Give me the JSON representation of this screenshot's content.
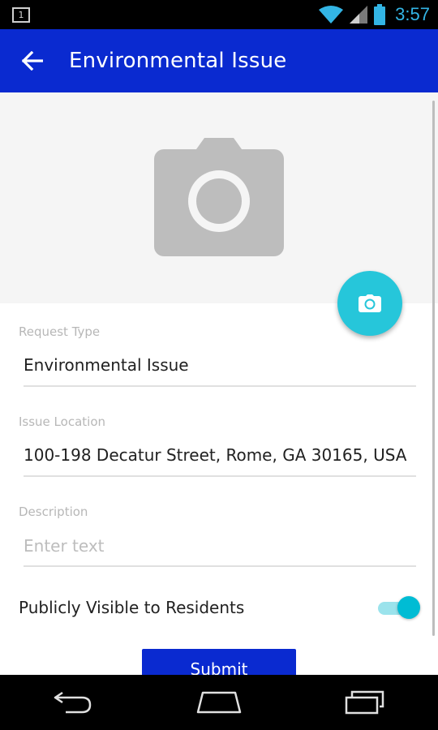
{
  "status_bar": {
    "notification_count": "1",
    "time": "3:57",
    "icons": [
      "wifi-icon",
      "cell-signal-icon",
      "battery-icon"
    ]
  },
  "app_bar": {
    "title": "Environmental Issue",
    "back_icon": "arrow-left-icon"
  },
  "photo": {
    "placeholder_icon": "camera-icon",
    "fab_icon": "camera-icon"
  },
  "form": {
    "request_type": {
      "label": "Request Type",
      "value": "Environmental Issue"
    },
    "issue_location": {
      "label": "Issue Location",
      "value": "100-198 Decatur Street, Rome, GA 30165, USA"
    },
    "description": {
      "label": "Description",
      "value": "",
      "placeholder": "Enter text"
    },
    "public_toggle": {
      "label": "Publicly Visible to Residents",
      "checked": true
    }
  },
  "submit": {
    "label": "Submit"
  },
  "nav": {
    "icons": [
      "back-nav-icon",
      "home-nav-icon",
      "recents-nav-icon"
    ]
  },
  "colors": {
    "primary": "#0a2ad0",
    "accent": "#26c6da",
    "status_time": "#33b5e5"
  }
}
